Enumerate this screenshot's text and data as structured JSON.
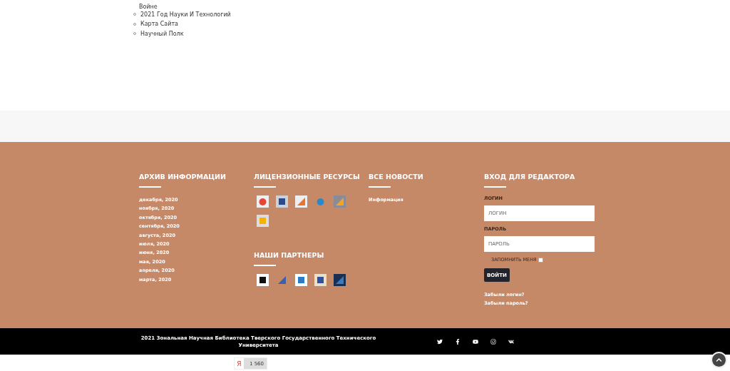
{
  "sitemap": {
    "continuation": "Войне",
    "items": [
      "2021 Год Науки И Технологий",
      "Карта Сайта",
      "Научный Полк"
    ]
  },
  "footer": {
    "archive": {
      "title": "АРХИВ ИНФОРМАЦИИ",
      "links": [
        "декабря, 2020",
        "ноября, 2020",
        "октября, 2020",
        "сентября, 2020",
        "августа, 2020",
        "июля, 2020",
        "июня, 2020",
        "мая, 2020",
        "апреля, 2020",
        "марта, 2020"
      ]
    },
    "resources": {
      "title": "ЛИЦЕНЗИОННЫЕ РЕСУРСЫ"
    },
    "partners": {
      "title": "НАШИ ПАРТНЕРЫ"
    },
    "news": {
      "title": "ВСЕ НОВОСТИ",
      "links": [
        "Информация"
      ]
    },
    "login": {
      "title": "ВХОД ДЛЯ РЕДАКТОРА",
      "login_label": "ЛОГИН",
      "login_placeholder": "ЛОГИН",
      "password_label": "ПАРОЛЬ",
      "password_placeholder": "ПАРОЛЬ",
      "remember_label": "ЗАПОМНИТЬ МЕНЯ",
      "remember_checked": false,
      "submit": "ВОЙТИ",
      "links": [
        "Забыли логин?",
        "Забыли пароль?"
      ]
    }
  },
  "bottom_bar": {
    "copyright": "2021  Зональная Научная Библиотека Тверского Государственного Технического Университета"
  },
  "counter": {
    "logo": "Я",
    "value": "1 560"
  }
}
